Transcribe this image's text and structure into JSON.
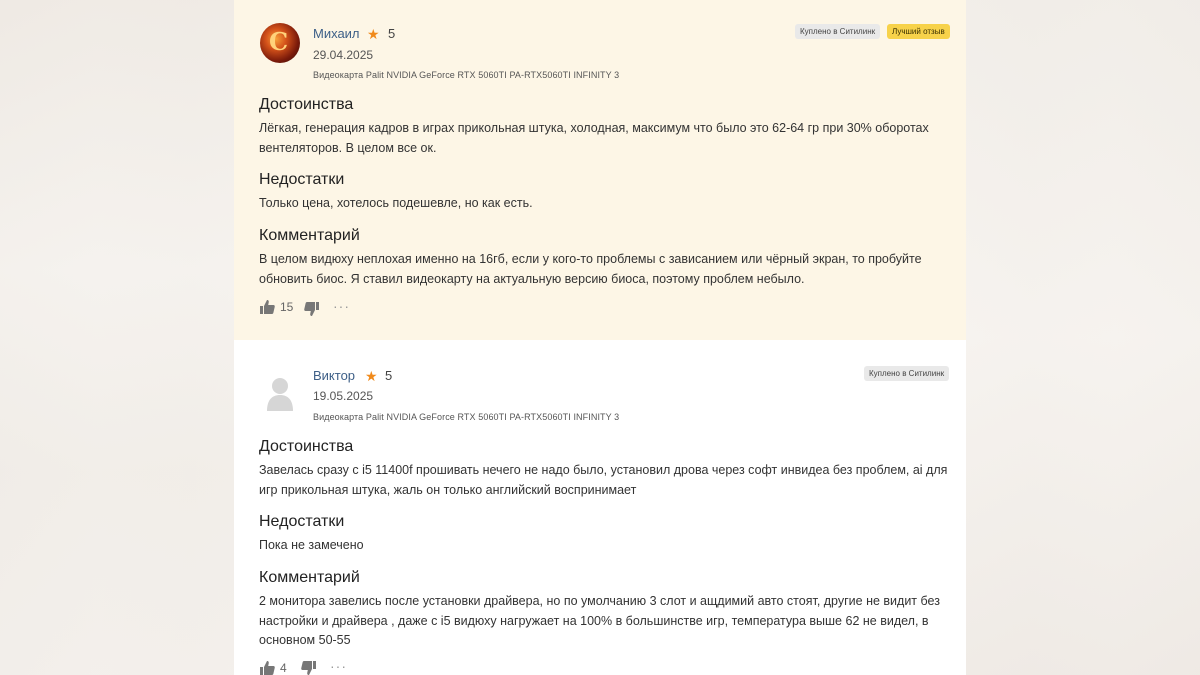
{
  "reviews": [
    {
      "author": "Михаил",
      "rating": "5",
      "date": "29.04.2025",
      "product": "Видеокарта Palit NVIDIA GeForce RTX 5060TI PA-RTX5060TI INFINITY 3",
      "badges": [
        "Куплено в Ситилинк",
        "Лучший отзыв"
      ],
      "sections": [
        {
          "title": "Достоинства",
          "text": "Лёгкая, генерация кадров в играх прикольная штука, холодная, максимум что было это 62-64 гр при 30% оборотах вентеляторов. В целом все ок."
        },
        {
          "title": "Недостатки",
          "text": "Только цена, хотелось подешевле, но как есть."
        },
        {
          "title": "Комментарий",
          "text": "В целом видюху неплохая именно на 16гб, если у кого-то проблемы с зависанием или чёрный экран, то пробуйте обновить биос. Я ставил видеокарту на актуальную версию биоса, поэтому проблем небыло."
        }
      ],
      "likes": "15",
      "more": "···"
    },
    {
      "author": "Виктор",
      "rating": "5",
      "date": "19.05.2025",
      "product": "Видеокарта Palit NVIDIA GeForce RTX 5060TI PA-RTX5060TI INFINITY 3",
      "badges": [
        "Куплено в Ситилинк"
      ],
      "sections": [
        {
          "title": "Достоинства",
          "text": "Завелась сразу с i5 11400f прошивать нечего не надо было, установил дрова через софт инвидеа без проблем, ai для игр прикольная штука, жаль он только английский воспринимает"
        },
        {
          "title": "Недостатки",
          "text": "Пока не замечено"
        },
        {
          "title": "Комментарий",
          "text": "2 монитора завелись после установки драйвера, но по умолчанию 3 слот и ащдимий авто стоят, другие не видит без настройки и драйвера , даже с i5 видюху нагружает на 100% в большинстве игр, температура выше 62 не видел, в основном 50-55"
        }
      ],
      "likes": "4",
      "more": "···"
    }
  ],
  "colors": {
    "highlight_bg": "#fdf6e6",
    "author_link": "#3d5f87",
    "star": "#f08a1c",
    "best_badge": "#f7d24a"
  },
  "icons": [
    "star-icon",
    "thumbs-up-icon",
    "thumbs-down-icon",
    "more-icon",
    "avatar-icon"
  ]
}
